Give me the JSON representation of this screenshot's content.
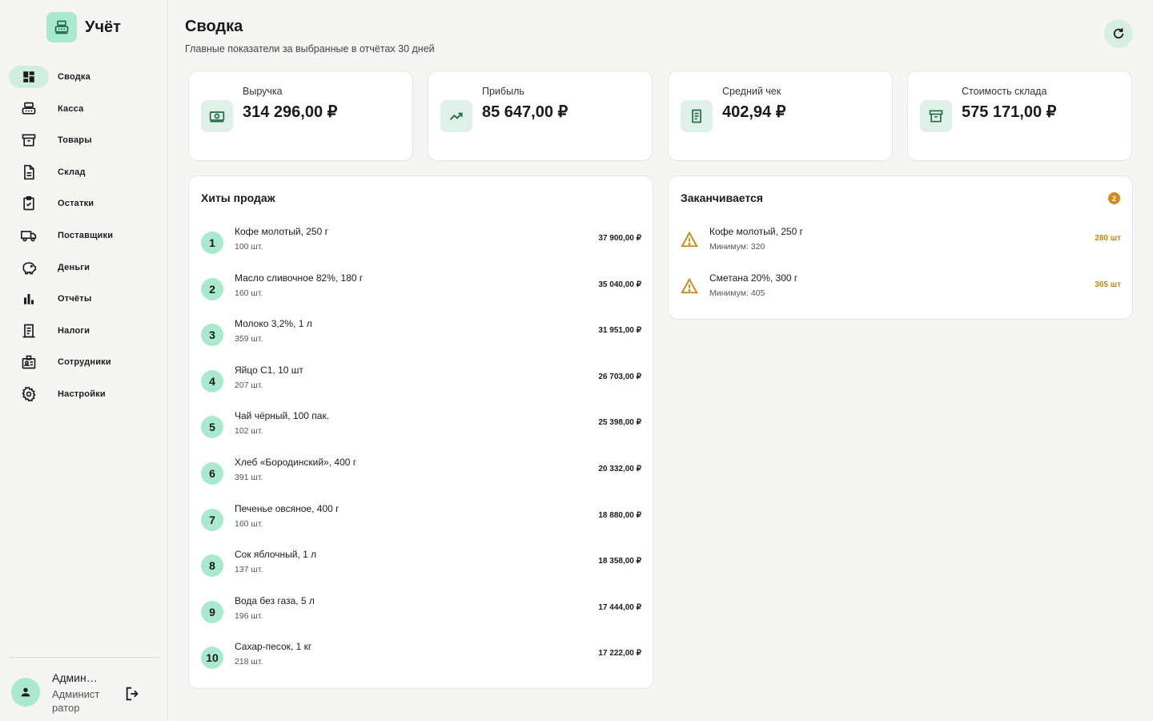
{
  "app": {
    "title": "Учёт"
  },
  "sidebar": {
    "items": [
      {
        "label": "Сводка",
        "icon": "dashboard-icon",
        "active": true
      },
      {
        "label": "Касса",
        "icon": "cash-register-icon"
      },
      {
        "label": "Товары",
        "icon": "archive-icon"
      },
      {
        "label": "Склад",
        "icon": "document-icon"
      },
      {
        "label": "Остатки",
        "icon": "clipboard-check-icon"
      },
      {
        "label": "Поставщики",
        "icon": "truck-icon"
      },
      {
        "label": "Деньги",
        "icon": "piggy-bank-icon"
      },
      {
        "label": "Отчёты",
        "icon": "bar-chart-icon"
      },
      {
        "label": "Налоги",
        "icon": "receipt-icon"
      },
      {
        "label": "Сотрудники",
        "icon": "badge-icon"
      },
      {
        "label": "Настройки",
        "icon": "gear-icon"
      }
    ]
  },
  "user": {
    "name": "Администратор",
    "role": "Администратор"
  },
  "header": {
    "title": "Сводка",
    "subtitle": "Главные показатели за выбранные в отчётах 30 дней"
  },
  "kpis": [
    {
      "label": "Выручка",
      "value": "314 296,00 ₽",
      "icon": "money-icon"
    },
    {
      "label": "Прибыль",
      "value": "85 647,00 ₽",
      "icon": "trending-up-icon"
    },
    {
      "label": "Средний чек",
      "value": "402,94 ₽",
      "icon": "receipt-icon"
    },
    {
      "label": "Стоимость склада",
      "value": "575 171,00 ₽",
      "icon": "archive-icon"
    }
  ],
  "hits": {
    "title": "Хиты продаж",
    "rows": [
      {
        "rank": "1",
        "name": "Кофе молотый, 250 г",
        "qty": "100 шт.",
        "amount": "37 900,00 ₽"
      },
      {
        "rank": "2",
        "name": "Масло сливочное 82%, 180 г",
        "qty": "160 шт.",
        "amount": "35 040,00 ₽"
      },
      {
        "rank": "3",
        "name": "Молоко 3,2%, 1 л",
        "qty": "359 шт.",
        "amount": "31 951,00 ₽"
      },
      {
        "rank": "4",
        "name": "Яйцо С1, 10 шт",
        "qty": "207 шт.",
        "amount": "26 703,00 ₽"
      },
      {
        "rank": "5",
        "name": "Чай чёрный, 100 пак.",
        "qty": "102 шт.",
        "amount": "25 398,00 ₽"
      },
      {
        "rank": "6",
        "name": "Хлеб «Бородинский», 400 г",
        "qty": "391 шт.",
        "amount": "20 332,00 ₽"
      },
      {
        "rank": "7",
        "name": "Печенье овсяное, 400 г",
        "qty": "160 шт.",
        "amount": "18 880,00 ₽"
      },
      {
        "rank": "8",
        "name": "Сок яблочный, 1 л",
        "qty": "137 шт.",
        "amount": "18 358,00 ₽"
      },
      {
        "rank": "9",
        "name": "Вода без газа, 5 л",
        "qty": "196 шт.",
        "amount": "17 444,00 ₽"
      },
      {
        "rank": "10",
        "name": "Сахар-песок, 1 кг",
        "qty": "218 шт.",
        "amount": "17 222,00 ₽"
      }
    ]
  },
  "low_stock": {
    "title": "Заканчивается",
    "count": "2",
    "rows": [
      {
        "name": "Кофе молотый, 250 г",
        "min": "Минимум: 320",
        "qty": "280 шт"
      },
      {
        "name": "Сметана 20%, 300 г",
        "min": "Минимум: 405",
        "qty": "365 шт"
      }
    ]
  },
  "colors": {
    "accent": "#a9eacf",
    "accent_dark": "#1f6b4f",
    "warning": "#d48a1c"
  }
}
